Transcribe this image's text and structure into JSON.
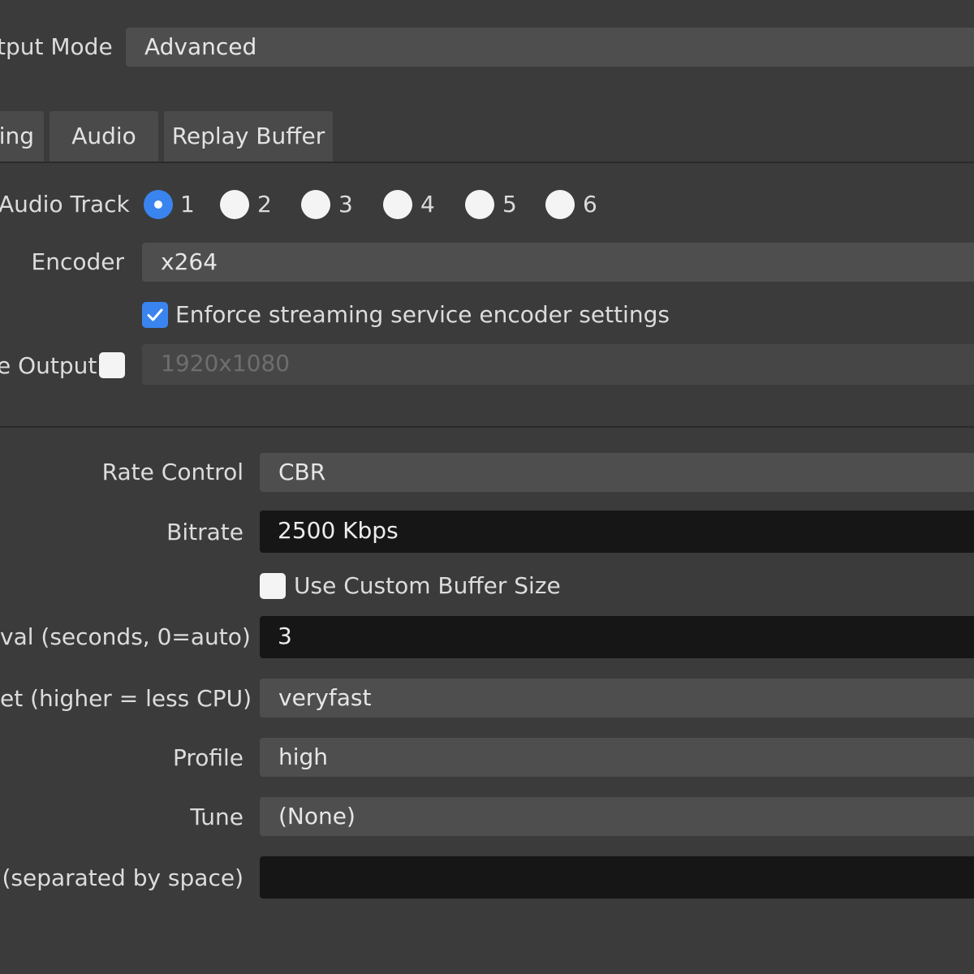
{
  "output_mode": {
    "label": "tput Mode",
    "value": "Advanced"
  },
  "tabs": [
    {
      "label": "ing"
    },
    {
      "label": "Audio"
    },
    {
      "label": "Replay Buffer"
    }
  ],
  "streaming": {
    "audio_track_label": "Audio Track",
    "audio_tracks": [
      "1",
      "2",
      "3",
      "4",
      "5",
      "6"
    ],
    "selected_track": "1",
    "encoder_label": "Encoder",
    "encoder_value": "x264",
    "enforce_label": "Enforce streaming service encoder settings",
    "enforce_checked": true,
    "rescale_label": "e Output",
    "rescale_checked": false,
    "rescale_value": "1920x1080"
  },
  "encoder_settings": {
    "rate_control_label": "Rate Control",
    "rate_control_value": "CBR",
    "bitrate_label": "Bitrate",
    "bitrate_value": "2500 Kbps",
    "custom_buffer_label": "Use Custom Buffer Size",
    "custom_buffer_checked": false,
    "keyframe_label": "val (seconds, 0=auto)",
    "keyframe_value": "3",
    "preset_label": "et (higher = less CPU)",
    "preset_value": "veryfast",
    "profile_label": "Profile",
    "profile_value": "high",
    "tune_label": "Tune",
    "tune_value": "(None)",
    "x264_options_label": "(separated by space)",
    "x264_options_value": ""
  },
  "colors": {
    "background": "#3b3b3b",
    "combo": "#4e4e4e",
    "field": "#161616",
    "accent": "#3a84f0"
  }
}
